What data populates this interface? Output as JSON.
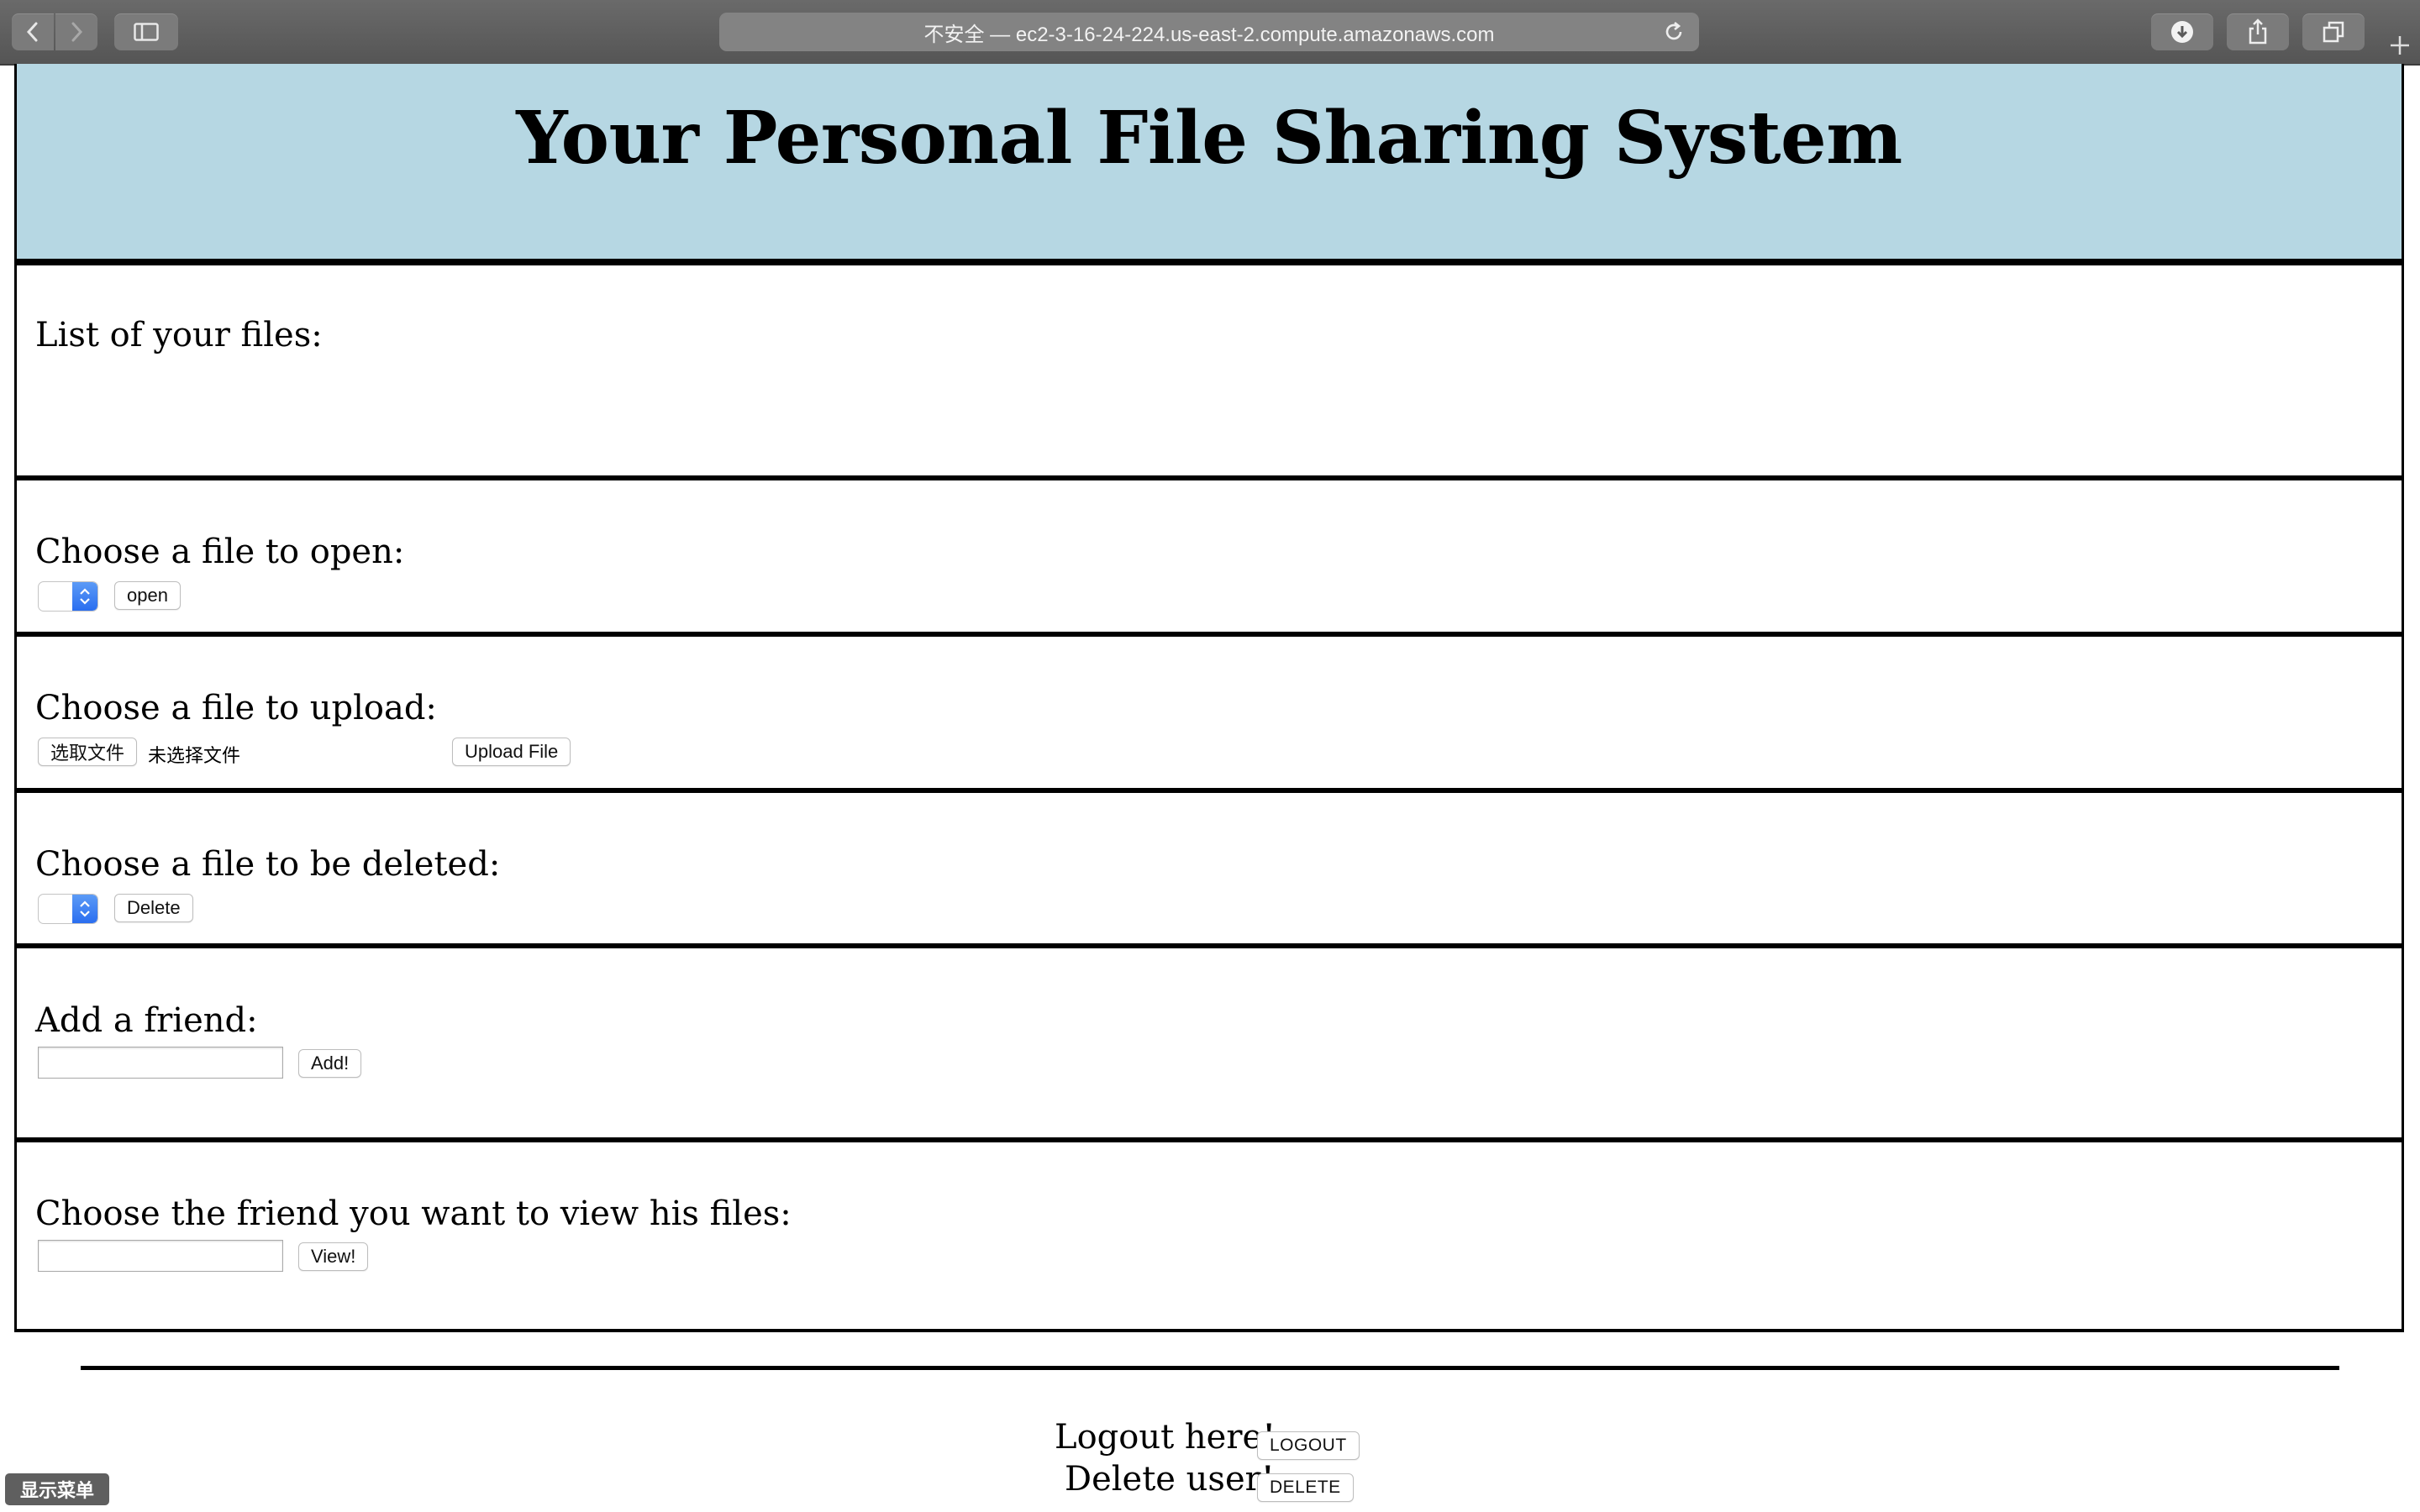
{
  "browser": {
    "url_text": "不安全 — ec2-3-16-24-224.us-east-2.compute.amazonaws.com"
  },
  "page": {
    "title": "Your Personal File Sharing System",
    "list_section": {
      "title": "List of your files:"
    },
    "open_section": {
      "title": "Choose a file to open:",
      "select_value": "",
      "button_label": "open"
    },
    "upload_section": {
      "title": "Choose a file to upload:",
      "choose_button_label": "选取文件",
      "no_file_text": "未选择文件",
      "upload_button_label": "Upload File"
    },
    "delete_section": {
      "title": "Choose a file to be deleted:",
      "select_value": "",
      "button_label": "Delete"
    },
    "friend_section": {
      "title": "Add a friend:",
      "input_value": "",
      "button_label": "Add!"
    },
    "view_section": {
      "title": "Choose the friend you want to view his files:",
      "input_value": "",
      "button_label": "View!"
    },
    "footer": {
      "logout_label": "Logout here!",
      "logout_button": "LOGOUT",
      "delete_user_label": "Delete user!",
      "delete_user_button": "DELETE"
    }
  },
  "overlay": {
    "menu_button_label": "显示菜单"
  },
  "colors": {
    "header_bg": "#b6d7e3",
    "select_accent": "#2a6ef0",
    "toolbar_bg": "#5e5e5e"
  }
}
